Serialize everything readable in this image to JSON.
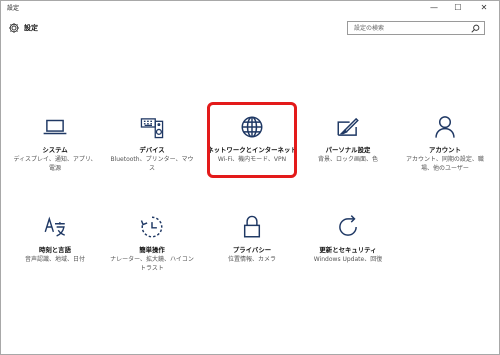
{
  "window": {
    "title": "設定",
    "minimize_glyph": "—",
    "maximize_glyph": "☐",
    "close_glyph": "✕"
  },
  "header": {
    "title": "設定",
    "icon": "gear-icon"
  },
  "search": {
    "placeholder": "設定の検索",
    "value": "",
    "icon": "search-icon"
  },
  "accent_color": "#1f3864",
  "highlight_color": "#e31a1a",
  "tiles": [
    {
      "id": "system",
      "icon": "laptop-icon",
      "name": "システム",
      "desc": "ディスプレイ、通知、アプリ、電源"
    },
    {
      "id": "devices",
      "icon": "keyboard-speaker-icon",
      "name": "デバイス",
      "desc": "Bluetooth、プリンター、マウス"
    },
    {
      "id": "network",
      "icon": "globe-icon",
      "name": "ネットワークとインターネット",
      "desc": "Wi-Fi、機内モード、VPN",
      "highlighted": true
    },
    {
      "id": "personalization",
      "icon": "paint-brush-icon",
      "name": "パーソナル設定",
      "desc": "背景、ロック画面、色"
    },
    {
      "id": "accounts",
      "icon": "person-icon",
      "name": "アカウント",
      "desc": "アカウント、同期の設定、職場、他のユーザー"
    },
    {
      "id": "time-language",
      "icon": "time-language-icon",
      "name": "時刻と言語",
      "desc": "音声認識、地域、日付"
    },
    {
      "id": "ease-of-access",
      "icon": "ease-of-access-icon",
      "name": "簡単操作",
      "desc": "ナレーター、拡大鏡、ハイコントラスト"
    },
    {
      "id": "privacy",
      "icon": "lock-icon",
      "name": "プライバシー",
      "desc": "位置情報、カメラ"
    },
    {
      "id": "update-security",
      "icon": "refresh-icon",
      "name": "更新とセキュリティ",
      "desc": "Windows Update、回復"
    }
  ]
}
